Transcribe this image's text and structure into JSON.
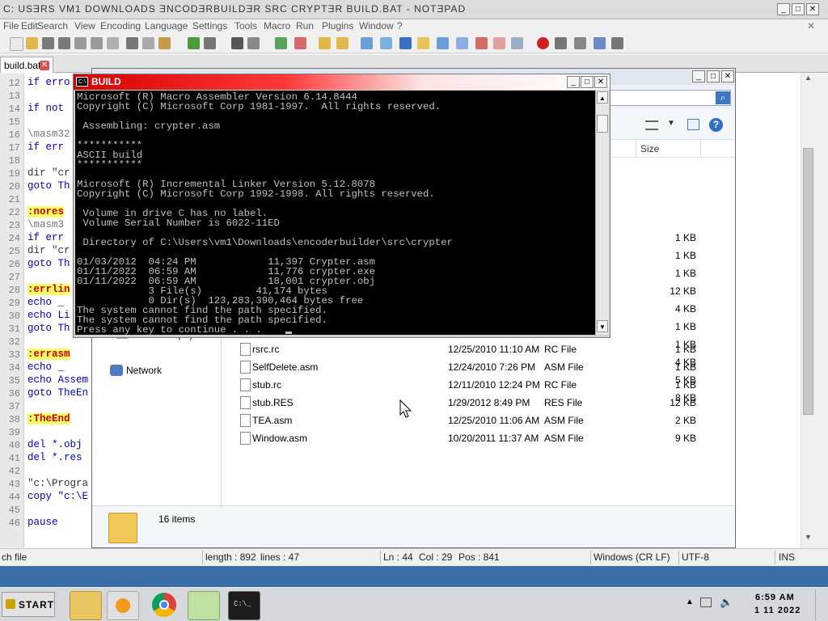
{
  "notepad": {
    "title": "C:\\Users\\vm1\\Downloads\\encoderbuilder\\src\\crypter\\build.bat - Notepad++",
    "title_display": "C: USƎRS VM1 DOWNLOADS ƎNCODƎRBUILDƎR SRC CRYPTƎR BUILD.BAT - NOTƎPAD",
    "menu": [
      "File",
      "Edit",
      "Search",
      "View",
      "Encoding",
      "Language",
      "Settings",
      "Tools",
      "Macro",
      "Run",
      "Plugins",
      "Window",
      "?"
    ],
    "tab": "build.bat",
    "line_numbers": [
      "12",
      "13",
      "14",
      "15",
      "16",
      "17",
      "18",
      "19",
      "20",
      "21",
      "22",
      "23",
      "24",
      "25",
      "26",
      "27",
      "28",
      "29",
      "30",
      "31",
      "32",
      "33",
      "34",
      "35",
      "36",
      "37",
      "38",
      "39",
      "40",
      "41",
      "42",
      "43",
      "44",
      "45",
      "46"
    ],
    "code": {
      "l12": "if erro",
      "l14": "if not",
      "l16": "\\masm32",
      "l17": " if err",
      "l19": "dir \"cr",
      "l20": "goto Th",
      "l22": ":nores",
      "l23": " \\masm3",
      "l24": " if err",
      "l25": "dir \"cr",
      "l26": "goto Th",
      "l28": ":errlin",
      "l29": " echo _",
      "l30": "echo Li",
      "l31": "goto Th",
      "l33": ":errasm",
      "l34": " echo _",
      "l35": "echo Assem",
      "l36": "goto TheEn",
      "l38": ":TheEnd",
      "l40": "del *.obj",
      "l41": "del *.res",
      "l43": "\"c:\\Progra",
      "l44": "copy \"c:\\E",
      "l46": "pause"
    },
    "status": {
      "type": "ch file",
      "length": "length : 892",
      "lines": "lines : 47",
      "ln": "Ln : 44",
      "col": "Col : 29",
      "pos": "Pos : 841",
      "eol": "Windows (CR LF)",
      "encoding": "UTF-8",
      "ins": "INS"
    }
  },
  "explorer": {
    "size_header": "Size",
    "partial_e": "le",
    "nav": {
      "local_disk": "Local Disk (C:)",
      "network": "Network"
    },
    "upper_sizes": [
      "1 KB",
      "1 KB",
      "1 KB",
      "12 KB",
      "4 KB",
      "1 KB",
      "1 KB",
      "4 KB",
      "5 KB",
      "8 KB"
    ],
    "files": [
      {
        "name": "rsrc.rc",
        "date": "12/25/2010 11:10 AM",
        "type": "RC File",
        "size": "1 KB"
      },
      {
        "name": "SelfDelete.asm",
        "date": "12/24/2010 7:26 PM",
        "type": "ASM File",
        "size": "1 KB"
      },
      {
        "name": "stub.rc",
        "date": "12/11/2010 12:24 PM",
        "type": "RC File",
        "size": "1 KB"
      },
      {
        "name": "stub.RES",
        "date": "1/29/2012 8:49 PM",
        "type": "RES File",
        "size": "12 KB"
      },
      {
        "name": "TEA.asm",
        "date": "12/25/2010 11:06 AM",
        "type": "ASM File",
        "size": "2 KB"
      },
      {
        "name": "Window.asm",
        "date": "10/20/2011 11:37 AM",
        "type": "ASM File",
        "size": "9 KB"
      }
    ],
    "item_count": "16 items"
  },
  "console": {
    "title": "BUILD",
    "lines": [
      "Microsoft (R) Macro Assembler Version 6.14.8444",
      "Copyright (C) Microsoft Corp 1981-1997.  All rights reserved.",
      "",
      " Assembling: crypter.asm",
      "",
      "***********",
      "ASCII build",
      "***********",
      "",
      "Microsoft (R) Incremental Linker Version 5.12.8078",
      "Copyright (C) Microsoft Corp 1992-1998. All rights reserved.",
      "",
      " Volume in drive C has no label.",
      " Volume Serial Number is 6022-11ED",
      "",
      " Directory of C:\\Users\\vm1\\Downloads\\encoderbuilder\\src\\crypter",
      "",
      "01/03/2012  04:24 PM            11,397 Crypter.asm",
      "01/11/2022  06:59 AM            11,776 crypter.exe",
      "01/11/2022  06:59 AM            18,001 crypter.obj",
      "            3 File(s)         41,174 bytes",
      "            0 Dir(s)  123,283,390,464 bytes free",
      "The system cannot find the path specified.",
      "The system cannot find the path specified.",
      "Press any key to continue . . ."
    ]
  },
  "taskbar": {
    "start": "START",
    "time": "6:59 AM",
    "date": "1 11 2022"
  },
  "colors": {
    "desktop": "#3a6ea5",
    "console_bg": "#000000",
    "console_fg": "#c0c0c0",
    "console_title": "#d40000",
    "label_hl": "#ffff66",
    "keyword": "#0000cc"
  }
}
